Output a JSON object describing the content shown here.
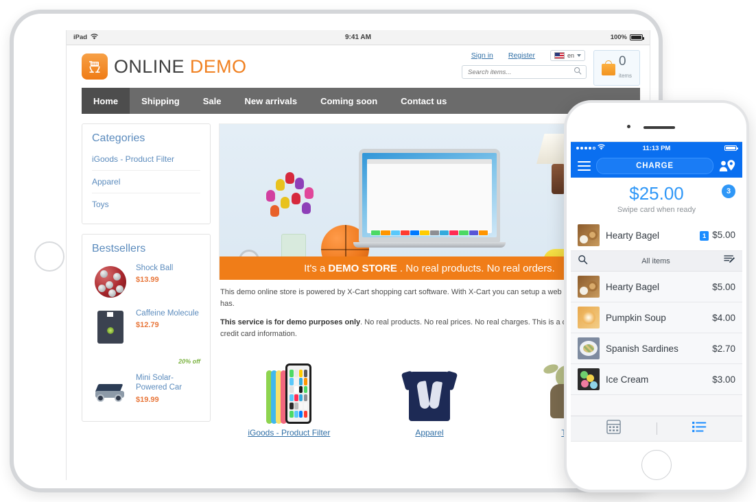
{
  "tablet": {
    "status_bar": {
      "device": "iPad",
      "wifi_icon": "wifi-icon",
      "time": "9:41 AM",
      "battery_percent": "100%"
    },
    "store": {
      "logo": {
        "icon": "shopping-cart-logo-icon",
        "text_primary": "ONLINE",
        "text_secondary": "DEMO"
      },
      "account": {
        "sign_in": "Sign in",
        "register": "Register"
      },
      "language": {
        "flag_icon": "us-flag-icon",
        "code": "en",
        "caret_icon": "chevron-down-icon"
      },
      "search": {
        "placeholder": "Search items...",
        "value": "",
        "icon": "search-icon"
      },
      "cart": {
        "icon": "shopping-bag-icon",
        "count": "0",
        "label": "items"
      },
      "nav": [
        {
          "label": "Home",
          "active": true
        },
        {
          "label": "Shipping",
          "active": false
        },
        {
          "label": "Sale",
          "active": false
        },
        {
          "label": "New arrivals",
          "active": false
        },
        {
          "label": "Coming soon",
          "active": false
        },
        {
          "label": "Contact us",
          "active": false
        }
      ],
      "categories_panel": {
        "title": "Categories",
        "items": [
          "iGoods - Product Filter",
          "Apparel",
          "Toys"
        ]
      },
      "bestsellers_panel": {
        "title": "Bestsellers",
        "items": [
          {
            "name": "Shock Ball",
            "price": "$13.99",
            "discount": ""
          },
          {
            "name": "Caffeine Molecule",
            "price": "$12.79",
            "discount": "20% off"
          },
          {
            "name": "Mini Solar-Powered Car",
            "price": "$19.99",
            "discount": ""
          }
        ]
      },
      "hero": {
        "banner_prefix": "It's a ",
        "banner_strong": "DEMO STORE",
        "banner_suffix": ". No real products. No real orders."
      },
      "body_copy": {
        "p1": "This demo online store is powered by X-Cart shopping cart software. With X-Cart you can setup a web store having a demo has.",
        "p2_strong": "This service is for demo purposes only",
        "p2_rest": ". No real products. No real prices. No real charges. This is a demonstration. real credit card information."
      },
      "category_cards": [
        {
          "link": "iGoods - Product Filter",
          "image": "iphone-5c-lineup-image"
        },
        {
          "link": "Apparel",
          "image": "navy-wings-tshirt-image"
        },
        {
          "link": "Toys",
          "image": "yoda-figure-image"
        }
      ]
    }
  },
  "phone": {
    "status_bar": {
      "signal_icon": "signal-dots-icon",
      "wifi_icon": "wifi-icon",
      "time": "11:13 PM",
      "battery_icon": "battery-icon"
    },
    "nav": {
      "menu_icon": "hamburger-menu-icon",
      "charge_label": "CHARGE",
      "customer_icon": "person-location-icon"
    },
    "amount": {
      "value": "$25.00",
      "subtitle": "Swipe card when ready",
      "badge": "3"
    },
    "cart_items": [
      {
        "name": "Hearty Bagel",
        "qty": "1",
        "price": "$5.00",
        "thumb": "bagel-thumb"
      }
    ],
    "all_items_section": {
      "search_icon": "search-icon",
      "title": "All items",
      "edit_icon": "edit-list-icon",
      "items": [
        {
          "name": "Hearty Bagel",
          "price": "$5.00",
          "thumb": "bagel-thumb"
        },
        {
          "name": "Pumpkin Soup",
          "price": "$4.00",
          "thumb": "soup-thumb"
        },
        {
          "name": "Spanish Sardines",
          "price": "$2.70",
          "thumb": "sardines-thumb"
        },
        {
          "name": "Ice Cream",
          "price": "$3.00",
          "thumb": "icecream-thumb"
        }
      ]
    },
    "tabs": [
      {
        "icon": "keypad-icon",
        "active": false
      },
      {
        "icon": "list-icon",
        "active": true
      }
    ]
  },
  "colors": {
    "brand_orange": "#f08020",
    "nav_gray": "#6b6b6b",
    "link_blue": "#2f6ea5",
    "panel_title_blue": "#5b8bbd",
    "price_orange": "#e8763a",
    "ios_blue": "#0a6ff0",
    "amount_blue": "#2f97f7",
    "discount_green": "#7cb342"
  }
}
